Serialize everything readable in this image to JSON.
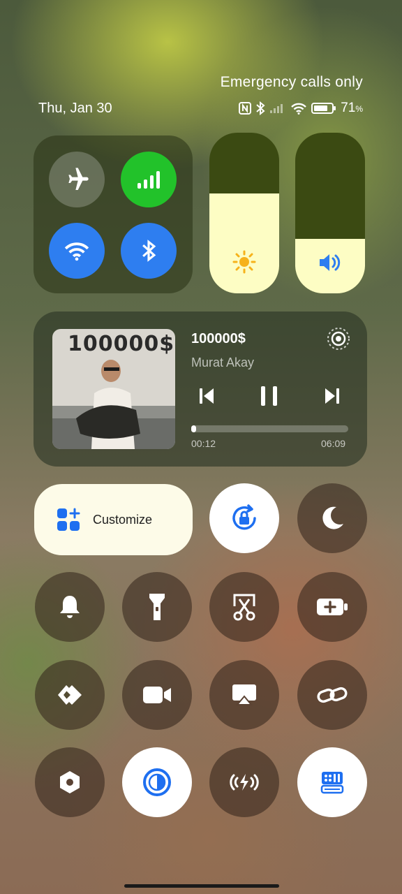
{
  "status_bar": {
    "emergency_text": "Emergency calls only",
    "date": "Thu, Jan 30",
    "battery_percent": "71",
    "battery_unit": "%",
    "icons": [
      "nfc-icon",
      "bluetooth-icon",
      "signal-icon",
      "wifi-icon",
      "battery-icon"
    ]
  },
  "connectivity": {
    "airplane": {
      "icon": "airplane-icon",
      "active": false
    },
    "mobile_data": {
      "icon": "cellular-signal-icon",
      "active": true,
      "color": "#22c22a"
    },
    "wifi": {
      "icon": "wifi-icon",
      "active": true,
      "color": "#2e7ef0"
    },
    "bluetooth": {
      "icon": "bluetooth-icon",
      "active": true,
      "color": "#2e7ef0"
    }
  },
  "sliders": {
    "brightness": {
      "icon": "sun-icon",
      "level": 0.62
    },
    "volume": {
      "icon": "speaker-icon",
      "level": 0.34
    }
  },
  "media": {
    "album_title": "100000$",
    "track_title": "100000$",
    "artist": "Murat Akay",
    "elapsed": "00:12",
    "total": "06:09",
    "progress": 0.033
  },
  "customize": {
    "label": "Customize",
    "icon": "grid-plus-icon"
  },
  "tiles": [
    {
      "icon": "rotation-lock-icon",
      "active": true
    },
    {
      "icon": "moon-icon",
      "active": false
    },
    {
      "icon": "bell-icon",
      "active": false
    },
    {
      "icon": "flashlight-icon",
      "active": false
    },
    {
      "icon": "screenshot-scissors-icon",
      "active": false
    },
    {
      "icon": "battery-saver-icon",
      "active": false
    },
    {
      "icon": "nearby-share-icon",
      "active": false
    },
    {
      "icon": "video-camera-icon",
      "active": false
    },
    {
      "icon": "screen-cast-icon",
      "active": false
    },
    {
      "icon": "link-icon",
      "active": false
    },
    {
      "icon": "settings-hexagon-icon",
      "active": false
    },
    {
      "icon": "reading-mode-icon",
      "active": true
    },
    {
      "icon": "wireless-charging-icon",
      "active": false
    },
    {
      "icon": "app-panel-icon",
      "active": true
    }
  ],
  "colors": {
    "accent_blue": "#1e6ff0",
    "accent_green": "#22c22a",
    "slider_fill": "#fdfdc4"
  }
}
